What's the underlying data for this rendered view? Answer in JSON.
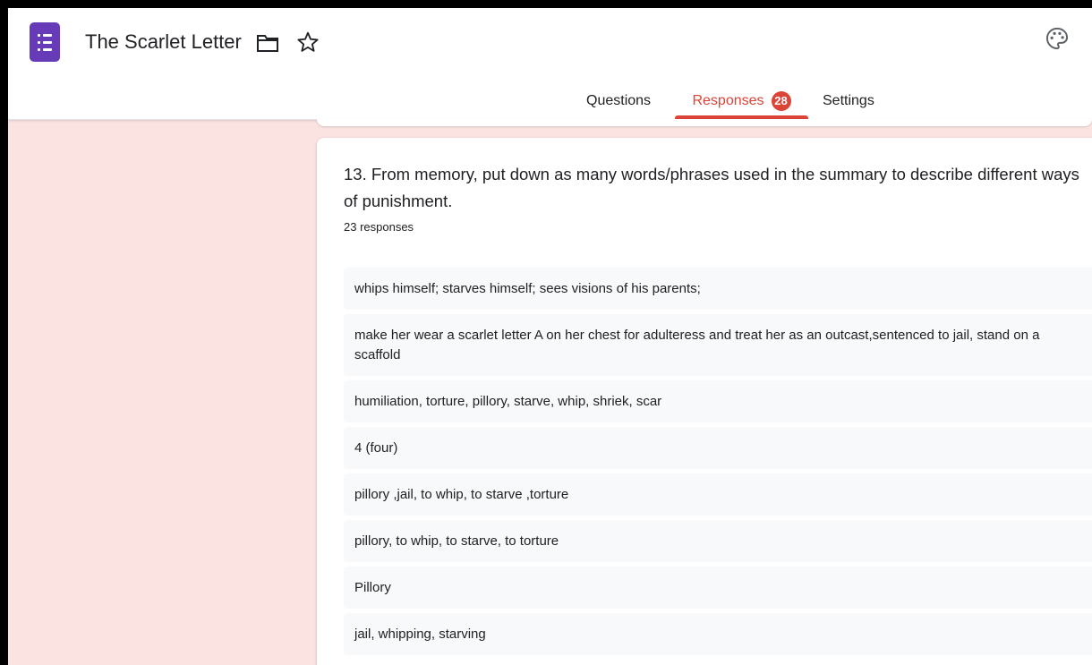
{
  "header": {
    "form_title": "The Scarlet Letter",
    "icons": [
      "forms-app-icon",
      "folder-icon",
      "star-icon",
      "palette-icon"
    ]
  },
  "tabs": {
    "questions": "Questions",
    "responses": "Responses",
    "responses_count": "28",
    "settings": "Settings",
    "active": "responses"
  },
  "question": {
    "text": "13. From memory, put down as many words/phrases used in the summary to describe different ways of punishment.",
    "response_count": "23 responses"
  },
  "responses": [
    "whips himself; starves himself; sees visions of his parents;",
    "make her wear a scarlet letter A on her chest for adulteress and treat her as an outcast,sentenced to jail, stand on a scaffold",
    "humiliation, torture, pillory, starve, whip, shriek, scar",
    "4 (four)",
    "pillory ,jail, to whip, to starve ,torture",
    "pillory, to whip, to starve, to torture",
    "Pillory",
    "jail, whipping, starving"
  ],
  "colors": {
    "accent": "#db4437",
    "background": "#fbe3e2",
    "app_icon": "#673ab7"
  }
}
